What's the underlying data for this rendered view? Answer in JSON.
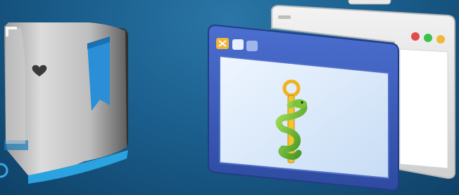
{
  "scene": {
    "title": "",
    "background_color": "#1b5f8e",
    "items": [
      {
        "name": "folder-with-bookmark",
        "icon": "folder-icon",
        "accent": "#2a8fd6"
      },
      {
        "name": "gray-browser-window",
        "icon": "window-icon",
        "buttons": [
          "#e44b4b",
          "#3cc24a",
          "#f0b73a"
        ]
      },
      {
        "name": "blue-window-with-snake-staff",
        "icon": "rod-of-asclepius-icon",
        "accent": "#3a59b8"
      }
    ]
  }
}
